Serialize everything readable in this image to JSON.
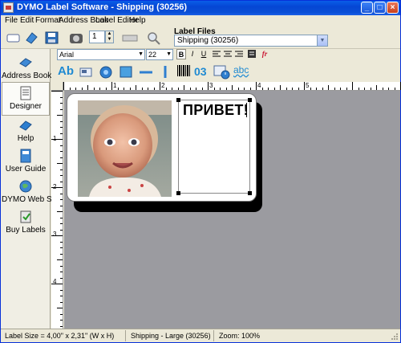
{
  "window": {
    "title": "DYMO Label Software - Shipping (30256)",
    "controls": {
      "minimize": "_",
      "maximize": "□",
      "close": "×"
    }
  },
  "menu": [
    "File",
    "Edit",
    "Format",
    "Address Book",
    "Label Editor",
    "Help"
  ],
  "toolbar": {
    "copies_value": "1",
    "label_files_caption": "Label Files",
    "label_files_selected": "Shipping (30256)"
  },
  "nav": [
    {
      "label": "Address Book",
      "icon": "address-book-icon"
    },
    {
      "label": "Designer",
      "icon": "designer-icon"
    },
    {
      "label": "Help",
      "icon": "help-book-icon"
    },
    {
      "label": "User Guide",
      "icon": "user-guide-icon"
    },
    {
      "label": "DYMO Web Site",
      "icon": "globe-icon"
    },
    {
      "label": "Buy Labels",
      "icon": "buy-labels-icon"
    }
  ],
  "format": {
    "font": "Arial",
    "size": "22",
    "bold": "B",
    "italic": "I",
    "underline": "U",
    "fr": "fr"
  },
  "insert_tools": {
    "text_tool": "Ab",
    "counter_tool": "03",
    "address_tool": "abc"
  },
  "rulers": {
    "h_numbers": [
      "1",
      "2",
      "3",
      "4",
      "5"
    ],
    "v_numbers": [
      "1",
      "2",
      "3",
      "4"
    ]
  },
  "label_text": "ПРИВЕТ!",
  "status": {
    "size": "Label Size = 4,00\" x 2,31\" (W x H)",
    "type": "Shipping - Large (30256)",
    "zoom": "Zoom: 100%"
  },
  "colors": {
    "titlebar": "#0a5ee8",
    "canvas": "#9b9ba0",
    "chrome": "#ece9d8"
  }
}
